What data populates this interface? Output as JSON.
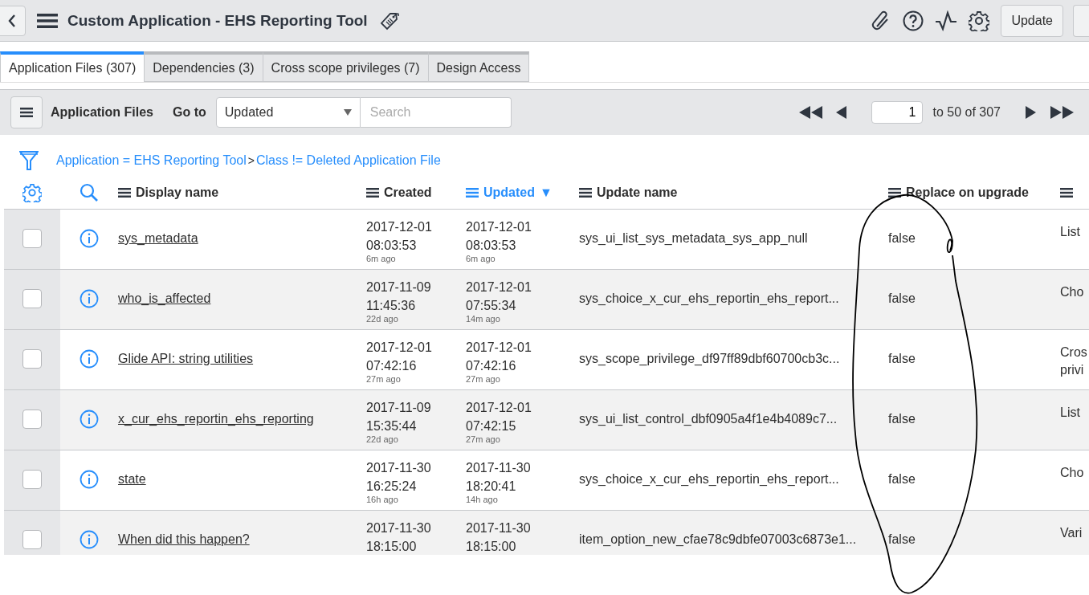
{
  "header": {
    "title": "Custom Application - EHS Reporting Tool",
    "update_button": "Update"
  },
  "tabs": [
    {
      "label": "Application Files (307)",
      "selected": true
    },
    {
      "label": "Dependencies (3)",
      "selected": false
    },
    {
      "label": "Cross scope privileges (7)",
      "selected": false
    },
    {
      "label": "Design Access",
      "selected": false
    }
  ],
  "toolbar": {
    "title": "Application Files",
    "goto_label": "Go to",
    "goto_value": "Updated",
    "search_placeholder": "Search",
    "page": "1",
    "range": "to 50 of 307"
  },
  "filter": {
    "conditions": [
      "Application = EHS Reporting Tool",
      "Class != Deleted Application File"
    ],
    "separator": ">"
  },
  "columns": [
    {
      "label": "Display name",
      "sorted": false
    },
    {
      "label": "Created",
      "sorted": false
    },
    {
      "label": "Updated",
      "sorted": true,
      "sort_indicator": "▼"
    },
    {
      "label": "Update name",
      "sorted": false
    },
    {
      "label": "Replace on upgrade",
      "sorted": false
    },
    {
      "sorted": false
    }
  ],
  "rows": [
    {
      "checked": false,
      "name": "sys_metadata",
      "created": [
        "2017-12-01",
        "08:03:53",
        "6m ago"
      ],
      "updated": [
        "2017-12-01",
        "08:03:53",
        "6m ago"
      ],
      "update_name": "sys_ui_list_sys_metadata_sys_app_null",
      "replace": "false",
      "column_7": [
        "List"
      ]
    },
    {
      "checked": false,
      "name": "who_is_affected",
      "created": [
        "2017-11-09",
        "11:45:36",
        "22d ago"
      ],
      "updated": [
        "2017-12-01",
        "07:55:34",
        "14m ago"
      ],
      "update_name": "sys_choice_x_cur_ehs_reportin_ehs_report...",
      "replace": "false",
      "column_7": [
        "Cho"
      ]
    },
    {
      "checked": false,
      "name": "Glide API: string utilities",
      "created": [
        "2017-12-01",
        "07:42:16",
        "27m ago"
      ],
      "updated": [
        "2017-12-01",
        "07:42:16",
        "27m ago"
      ],
      "update_name": "sys_scope_privilege_df97ff89dbf60700cb3c...",
      "replace": "false",
      "column_7": [
        "Cros",
        "privi"
      ]
    },
    {
      "checked": false,
      "name": "x_cur_ehs_reportin_ehs_reporting",
      "created": [
        "2017-11-09",
        "15:35:44",
        "22d ago"
      ],
      "updated": [
        "2017-12-01",
        "07:42:15",
        "27m ago"
      ],
      "update_name": "sys_ui_list_control_dbf0905a4f1e4b4089c7...",
      "replace": "false",
      "column_7": [
        "List"
      ]
    },
    {
      "checked": false,
      "name": "state",
      "created": [
        "2017-11-30",
        "16:25:24",
        "16h ago"
      ],
      "updated": [
        "2017-11-30",
        "18:20:41",
        "14h ago"
      ],
      "update_name": "sys_choice_x_cur_ehs_reportin_ehs_report...",
      "replace": "false",
      "column_7": [
        "Cho"
      ]
    },
    {
      "checked": false,
      "name": "When did this happen?",
      "created": [
        "2017-11-30",
        "18:15:00"
      ],
      "updated": [
        "2017-11-30",
        "18:15:00"
      ],
      "update_name": "item_option_new_cfae78c9dbfe07003c6873e1...",
      "replace": "false",
      "column_7": [
        "Vari"
      ]
    }
  ]
}
